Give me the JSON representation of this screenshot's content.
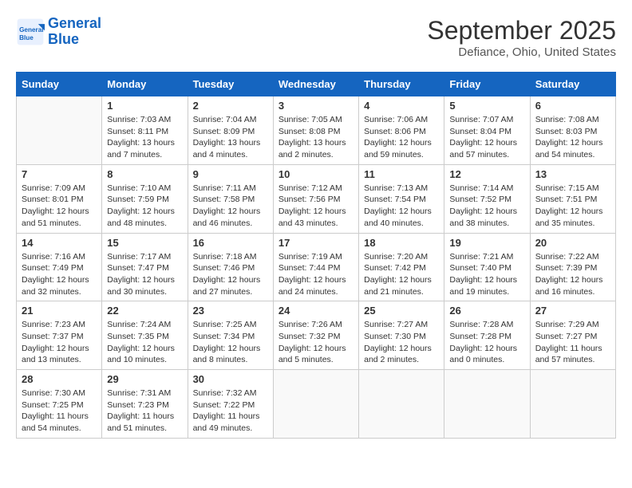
{
  "header": {
    "logo_line1": "General",
    "logo_line2": "Blue",
    "month": "September 2025",
    "location": "Defiance, Ohio, United States"
  },
  "days_of_week": [
    "Sunday",
    "Monday",
    "Tuesday",
    "Wednesday",
    "Thursday",
    "Friday",
    "Saturday"
  ],
  "weeks": [
    [
      {
        "num": "",
        "info": ""
      },
      {
        "num": "1",
        "info": "Sunrise: 7:03 AM\nSunset: 8:11 PM\nDaylight: 13 hours\nand 7 minutes."
      },
      {
        "num": "2",
        "info": "Sunrise: 7:04 AM\nSunset: 8:09 PM\nDaylight: 13 hours\nand 4 minutes."
      },
      {
        "num": "3",
        "info": "Sunrise: 7:05 AM\nSunset: 8:08 PM\nDaylight: 13 hours\nand 2 minutes."
      },
      {
        "num": "4",
        "info": "Sunrise: 7:06 AM\nSunset: 8:06 PM\nDaylight: 12 hours\nand 59 minutes."
      },
      {
        "num": "5",
        "info": "Sunrise: 7:07 AM\nSunset: 8:04 PM\nDaylight: 12 hours\nand 57 minutes."
      },
      {
        "num": "6",
        "info": "Sunrise: 7:08 AM\nSunset: 8:03 PM\nDaylight: 12 hours\nand 54 minutes."
      }
    ],
    [
      {
        "num": "7",
        "info": "Sunrise: 7:09 AM\nSunset: 8:01 PM\nDaylight: 12 hours\nand 51 minutes."
      },
      {
        "num": "8",
        "info": "Sunrise: 7:10 AM\nSunset: 7:59 PM\nDaylight: 12 hours\nand 48 minutes."
      },
      {
        "num": "9",
        "info": "Sunrise: 7:11 AM\nSunset: 7:58 PM\nDaylight: 12 hours\nand 46 minutes."
      },
      {
        "num": "10",
        "info": "Sunrise: 7:12 AM\nSunset: 7:56 PM\nDaylight: 12 hours\nand 43 minutes."
      },
      {
        "num": "11",
        "info": "Sunrise: 7:13 AM\nSunset: 7:54 PM\nDaylight: 12 hours\nand 40 minutes."
      },
      {
        "num": "12",
        "info": "Sunrise: 7:14 AM\nSunset: 7:52 PM\nDaylight: 12 hours\nand 38 minutes."
      },
      {
        "num": "13",
        "info": "Sunrise: 7:15 AM\nSunset: 7:51 PM\nDaylight: 12 hours\nand 35 minutes."
      }
    ],
    [
      {
        "num": "14",
        "info": "Sunrise: 7:16 AM\nSunset: 7:49 PM\nDaylight: 12 hours\nand 32 minutes."
      },
      {
        "num": "15",
        "info": "Sunrise: 7:17 AM\nSunset: 7:47 PM\nDaylight: 12 hours\nand 30 minutes."
      },
      {
        "num": "16",
        "info": "Sunrise: 7:18 AM\nSunset: 7:46 PM\nDaylight: 12 hours\nand 27 minutes."
      },
      {
        "num": "17",
        "info": "Sunrise: 7:19 AM\nSunset: 7:44 PM\nDaylight: 12 hours\nand 24 minutes."
      },
      {
        "num": "18",
        "info": "Sunrise: 7:20 AM\nSunset: 7:42 PM\nDaylight: 12 hours\nand 21 minutes."
      },
      {
        "num": "19",
        "info": "Sunrise: 7:21 AM\nSunset: 7:40 PM\nDaylight: 12 hours\nand 19 minutes."
      },
      {
        "num": "20",
        "info": "Sunrise: 7:22 AM\nSunset: 7:39 PM\nDaylight: 12 hours\nand 16 minutes."
      }
    ],
    [
      {
        "num": "21",
        "info": "Sunrise: 7:23 AM\nSunset: 7:37 PM\nDaylight: 12 hours\nand 13 minutes."
      },
      {
        "num": "22",
        "info": "Sunrise: 7:24 AM\nSunset: 7:35 PM\nDaylight: 12 hours\nand 10 minutes."
      },
      {
        "num": "23",
        "info": "Sunrise: 7:25 AM\nSunset: 7:34 PM\nDaylight: 12 hours\nand 8 minutes."
      },
      {
        "num": "24",
        "info": "Sunrise: 7:26 AM\nSunset: 7:32 PM\nDaylight: 12 hours\nand 5 minutes."
      },
      {
        "num": "25",
        "info": "Sunrise: 7:27 AM\nSunset: 7:30 PM\nDaylight: 12 hours\nand 2 minutes."
      },
      {
        "num": "26",
        "info": "Sunrise: 7:28 AM\nSunset: 7:28 PM\nDaylight: 12 hours\nand 0 minutes."
      },
      {
        "num": "27",
        "info": "Sunrise: 7:29 AM\nSunset: 7:27 PM\nDaylight: 11 hours\nand 57 minutes."
      }
    ],
    [
      {
        "num": "28",
        "info": "Sunrise: 7:30 AM\nSunset: 7:25 PM\nDaylight: 11 hours\nand 54 minutes."
      },
      {
        "num": "29",
        "info": "Sunrise: 7:31 AM\nSunset: 7:23 PM\nDaylight: 11 hours\nand 51 minutes."
      },
      {
        "num": "30",
        "info": "Sunrise: 7:32 AM\nSunset: 7:22 PM\nDaylight: 11 hours\nand 49 minutes."
      },
      {
        "num": "",
        "info": ""
      },
      {
        "num": "",
        "info": ""
      },
      {
        "num": "",
        "info": ""
      },
      {
        "num": "",
        "info": ""
      }
    ]
  ]
}
